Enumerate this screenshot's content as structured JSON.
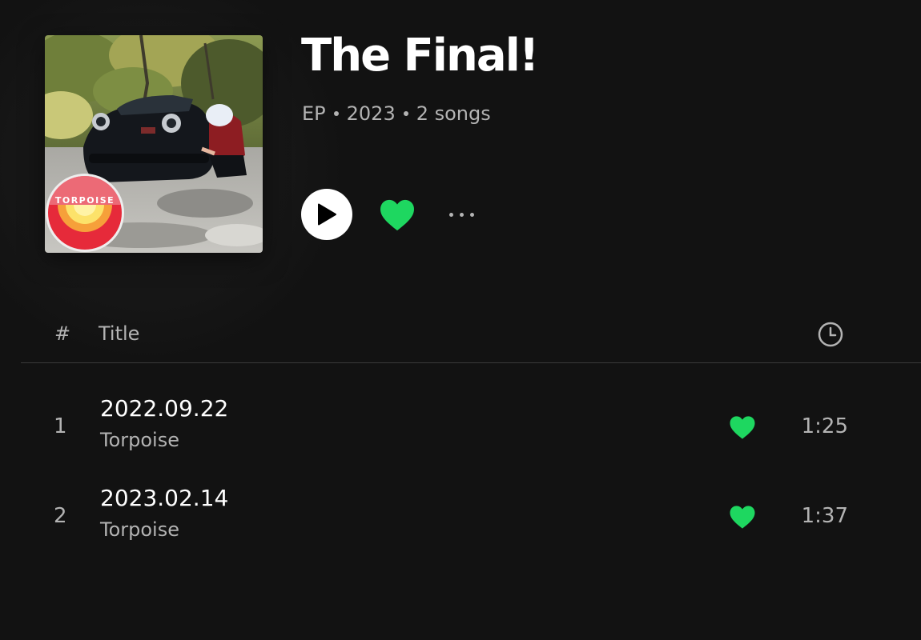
{
  "album": {
    "title": "The Final!",
    "type": "EP",
    "year": "2023",
    "song_count": "2 songs",
    "cover_logo_text": "TORPOISE"
  },
  "actions": {
    "play_icon": "play-icon",
    "like_icon": "heart-icon",
    "more_icon": "more-options-icon",
    "liked": true
  },
  "list_header": {
    "number_label": "#",
    "title_label": "Title",
    "duration_icon": "clock-icon"
  },
  "tracks": [
    {
      "number": "1",
      "title": "2022.09.22",
      "artist": "Torpoise",
      "duration": "1:25",
      "liked": true
    },
    {
      "number": "2",
      "title": "2023.02.14",
      "artist": "Torpoise",
      "duration": "1:37",
      "liked": true
    }
  ],
  "colors": {
    "background": "#121212",
    "accent_green": "#1ed760",
    "text_primary": "#ffffff",
    "text_secondary": "#b3b3b3"
  }
}
